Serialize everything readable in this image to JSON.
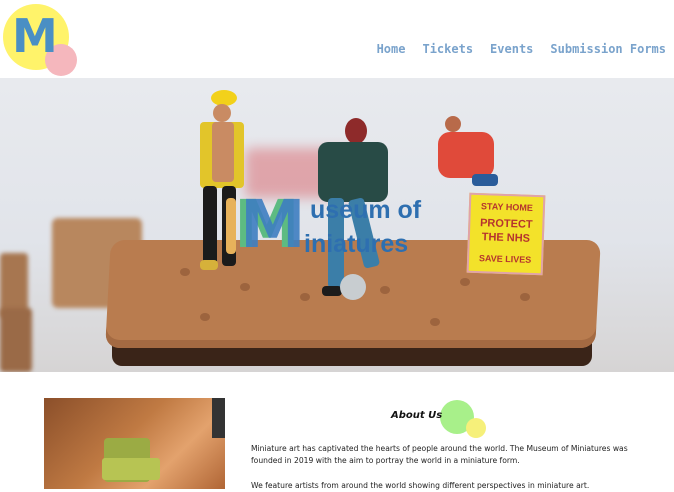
{
  "header": {
    "logo_letter": "M",
    "nav": [
      "Home",
      "Tickets",
      "Events",
      "Submission Forms"
    ]
  },
  "hero": {
    "title_letter": "M",
    "title_line1": "useum of",
    "title_line2": "iniatures",
    "sign_lines": [
      "STAY HOME",
      "PROTECT",
      "THE NHS",
      "SAVE LIVES"
    ]
  },
  "about": {
    "heading": "About Us",
    "paragraph1": "Miniature art has captivated the hearts of people around the world. The Museum of Miniatures was founded in 2019 with the aim to portray the world in a miniature form.",
    "paragraph2": "We feature artists from around the world showing different perspectives in miniature art."
  },
  "colors": {
    "nav": "#7aa3cc",
    "logo_yellow": "#fff36a",
    "logo_pink": "#f5b7bd",
    "title_blue": "#2e6fb0",
    "title_green": "#5dbb82"
  }
}
